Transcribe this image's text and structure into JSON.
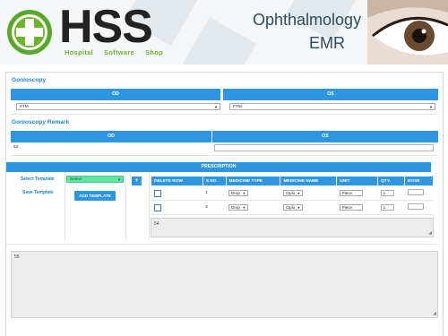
{
  "header": {
    "logo_letters": "HSS",
    "logo_words": [
      "Hospital",
      "Software",
      "Shop"
    ],
    "module_title": "Ophthalmology",
    "module_subtitle": "EMR"
  },
  "gonioscopy": {
    "title": "Gonioscopy",
    "od_header": "OD",
    "os_header": "OS",
    "od_value": "ATM",
    "os_value": "FTM"
  },
  "gonioscopy_remark": {
    "title": "Gonioscopy Remark",
    "od_header": "OD",
    "os_header": "OS",
    "od_value": "52",
    "os_value": ""
  },
  "prescription": {
    "title": "PRESCRIPTION",
    "select_template_label": "Select Template",
    "select_template_value": "Select",
    "save_template_label": "Save Template",
    "add_template_button": "ADD TEMPLATE",
    "add_row_button": "+",
    "columns": [
      "DELETE ROW",
      "S NO.",
      "MEDICINE TYPE",
      "MEDICINE NAME",
      "UNIT",
      "QTY.",
      "DOSE"
    ],
    "rows": [
      {
        "sno": "1",
        "type": "Drop",
        "name": "Ciplo",
        "unit": "Piece",
        "qty": "1",
        "dose": ""
      },
      {
        "sno": "2",
        "type": "Drop",
        "name": "Ciplo",
        "unit": "Piece",
        "qty": "1",
        "dose": ""
      }
    ],
    "notes_value": "54"
  },
  "remarks_value": "55",
  "colors": {
    "accent_blue": "#2e95e0",
    "title_blue": "#1c85c8",
    "template_green": "#5fe3a1",
    "logo_green": "#6fb22c"
  }
}
